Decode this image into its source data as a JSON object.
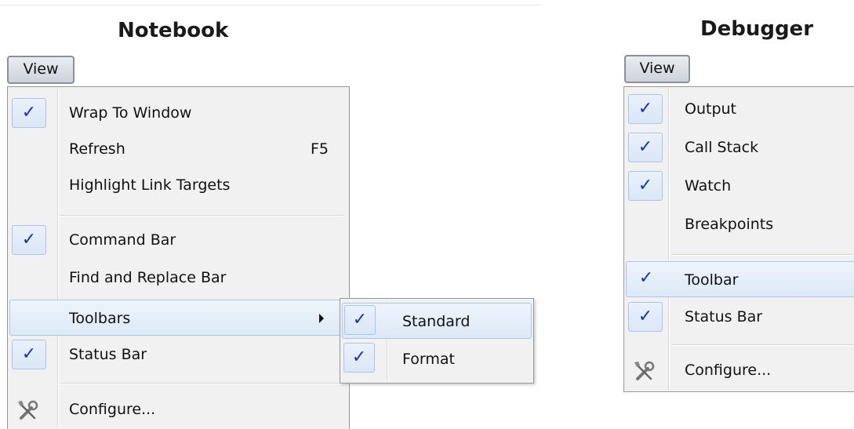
{
  "notebook": {
    "title": "Notebook",
    "menu_button": "View",
    "items": [
      {
        "label": "Wrap To Window",
        "checked": true
      },
      {
        "label": "Refresh",
        "shortcut": "F5",
        "checked": false
      },
      {
        "label": "Highlight Link Targets",
        "checked": false
      },
      {
        "label": "Command Bar",
        "checked": true
      },
      {
        "label": "Find and Replace Bar",
        "checked": false
      },
      {
        "label": "Toolbars",
        "checked": false,
        "has_submenu": true,
        "highlighted": true
      },
      {
        "label": "Status Bar",
        "checked": true
      },
      {
        "label": "Configure...",
        "icon": "tools-icon"
      }
    ],
    "toolbars_submenu": [
      {
        "label": "Standard",
        "checked": true,
        "highlighted": true
      },
      {
        "label": "Format",
        "checked": true
      }
    ]
  },
  "debugger": {
    "title": "Debugger",
    "menu_button": "View",
    "items": [
      {
        "label": "Output",
        "checked": true
      },
      {
        "label": "Call Stack",
        "checked": true
      },
      {
        "label": "Watch",
        "checked": true
      },
      {
        "label": "Breakpoints",
        "checked": false
      },
      {
        "label": "Toolbar",
        "checked": true,
        "highlighted": true
      },
      {
        "label": "Status Bar",
        "checked": true
      },
      {
        "label": "Configure...",
        "icon": "tools-icon"
      }
    ]
  },
  "check_glyph": "✓",
  "colors": {
    "check": "#1133cc",
    "highlight_border": "#a9c6ea",
    "menu_bg": "#f1f1f1"
  }
}
